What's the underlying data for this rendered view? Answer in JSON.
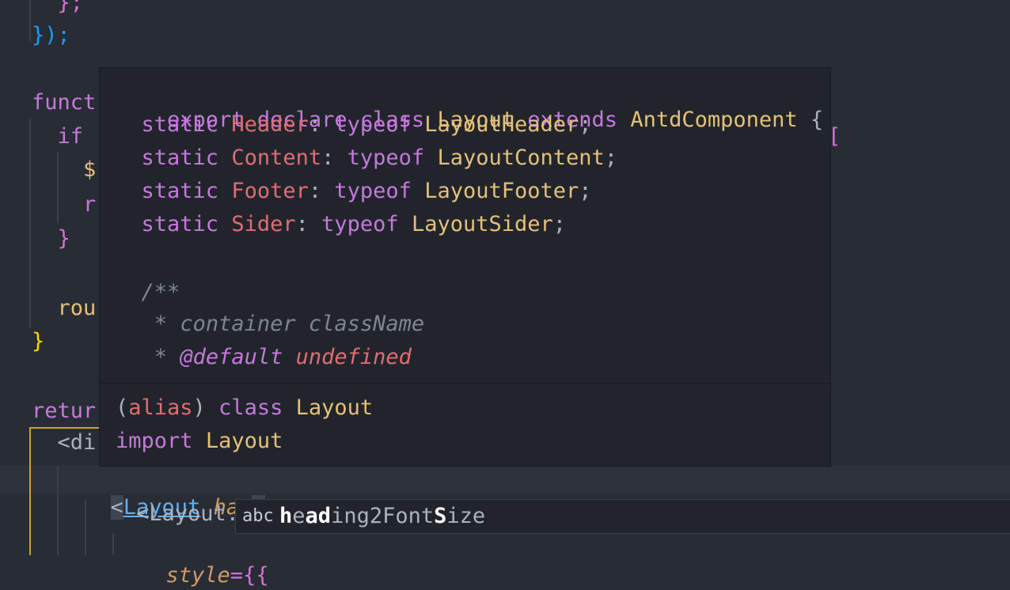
{
  "editor": {
    "lines": [
      {
        "text": "  };"
      },
      {
        "text": "});"
      },
      {
        "text": "funct"
      },
      {
        "text": "  if"
      },
      {
        "text": "    $"
      },
      {
        "text": "    r"
      },
      {
        "text": "  }"
      },
      {
        "text": "  rou"
      },
      {
        "text": "}"
      },
      {
        "text": "retur"
      },
      {
        "text": "  <di"
      },
      {
        "tag_open": "<",
        "tag_name": "Layout",
        "attr": "has",
        "tag_close": ">"
      },
      {
        "text": "    <Layout.S"
      },
      {
        "attr": "style",
        "eq": "=",
        "braces": "{{"
      }
    ],
    "stray_bracket": "["
  },
  "hover": {
    "signature": {
      "kw1": "export",
      "kw2": "declare",
      "kw3": "class",
      "name": "Layout",
      "kw4": "extends",
      "base": "AntdComponent",
      "brace": "{"
    },
    "members": [
      {
        "kw": "static",
        "name": "Header",
        "colon": ":",
        "typeof": "typeof",
        "type": "LayoutHeader",
        "semi": ";"
      },
      {
        "kw": "static",
        "name": "Content",
        "colon": ":",
        "typeof": "typeof",
        "type": "LayoutContent",
        "semi": ";"
      },
      {
        "kw": "static",
        "name": "Footer",
        "colon": ":",
        "typeof": "typeof",
        "type": "LayoutFooter",
        "semi": ";"
      },
      {
        "kw": "static",
        "name": "Sider",
        "colon": ":",
        "typeof": "typeof",
        "type": "LayoutSider",
        "semi": ";"
      }
    ],
    "doc": {
      "open": "/**",
      "line1_star": "*",
      "line1_text": "container className",
      "line2_star": "*",
      "line2_tag": "@default",
      "line2_value": "undefined"
    },
    "footer": {
      "paren_open": "(",
      "alias": "alias",
      "paren_close": ")",
      "kw_class": "class",
      "class_name": "Layout",
      "kw_import": "import",
      "import_name": "Layout"
    }
  },
  "suggest": {
    "kind_icon": "abc",
    "label_parts": [
      {
        "t": "h",
        "m": true
      },
      {
        "t": "e",
        "m": false
      },
      {
        "t": "a",
        "m": true
      },
      {
        "t": "d",
        "m": true
      },
      {
        "t": "ing2Font",
        "m": false
      },
      {
        "t": "S",
        "m": true
      },
      {
        "t": "ize",
        "m": false
      }
    ]
  },
  "colors": {
    "background": "#282c34",
    "hover_bg": "#21252b",
    "keyword": "#c678dd",
    "type": "#e5c07b",
    "property": "#e06c75",
    "comment": "#7f848e",
    "link": "#61afef"
  }
}
